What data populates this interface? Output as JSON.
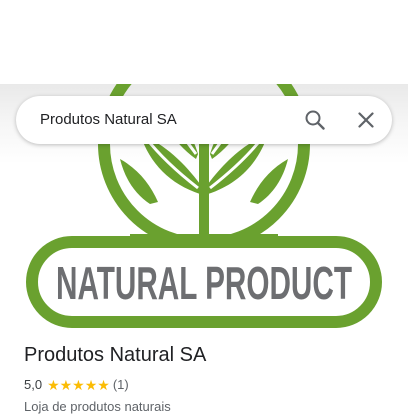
{
  "search": {
    "query": "Produtos Natural SA"
  },
  "hero": {
    "logo_text": "NATURAL PRODUCT",
    "brand_color": "#6aa12f",
    "text_color": "#6d6e71"
  },
  "place": {
    "name": "Produtos Natural SA",
    "rating": "5,0",
    "stars": "★★★★★",
    "review_count": "(1)",
    "category": "Loja de produtos naturais"
  },
  "icons": {
    "search": "search-icon",
    "close": "close-icon"
  }
}
